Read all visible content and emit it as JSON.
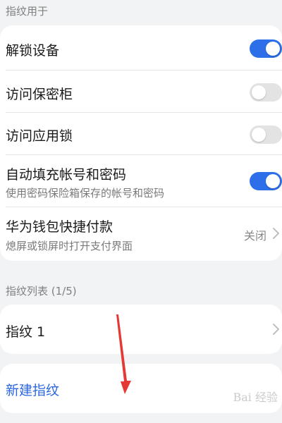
{
  "sections": {
    "usage_title": "指纹用于",
    "list_title": "指纹列表 (1/5)"
  },
  "usage": {
    "unlock_device": {
      "label": "解锁设备",
      "enabled": true
    },
    "access_safe": {
      "label": "访问保密柜",
      "enabled": false
    },
    "app_lock": {
      "label": "访问应用锁",
      "enabled": false
    },
    "autofill": {
      "label": "自动填充帐号和密码",
      "subtitle": "使用密码保险箱保存的帐号和密码",
      "enabled": true
    },
    "wallet": {
      "label": "华为钱包快捷付款",
      "subtitle": "熄屏或锁屏时打开支付界面",
      "value": "关闭"
    }
  },
  "fingerprints": [
    {
      "label": "指纹 1"
    }
  ],
  "new_fingerprint_label": "新建指纹",
  "colors": {
    "accent": "#2d6fe8",
    "link": "#2b66e0",
    "annotation_arrow": "#e53935"
  },
  "icons": {
    "chevron": "chevron-right-icon",
    "arrow": "red-annotation-arrow"
  }
}
